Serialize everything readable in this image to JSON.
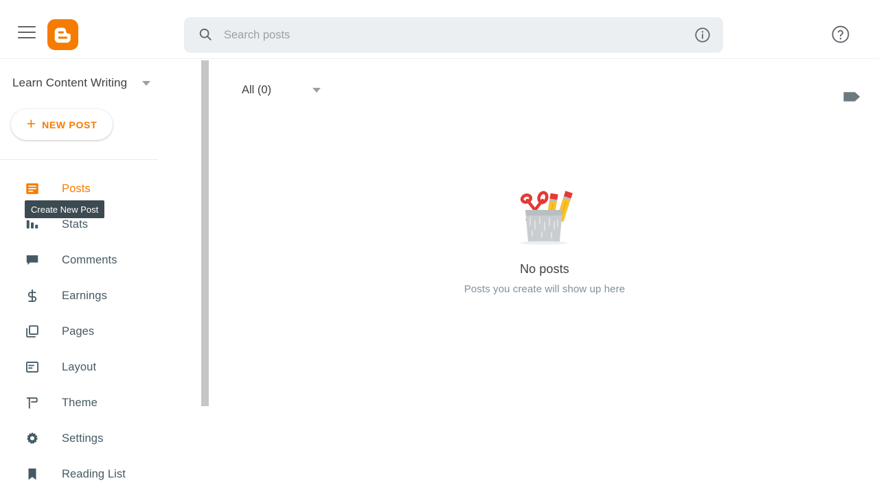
{
  "header": {
    "menu_icon": "hamburger-menu-icon",
    "logo_icon": "blogger-logo-icon",
    "search": {
      "icon": "search-icon",
      "placeholder": "Search posts",
      "value": "",
      "info_icon": "info-icon"
    },
    "help_icon": "help-circle-icon"
  },
  "sidebar": {
    "blog_title": "Learn Content Writing",
    "blog_switch_icon": "chevron-down-icon",
    "new_post": {
      "plus": "+",
      "label": "NEW POST",
      "tooltip": "Create New Post"
    },
    "items": [
      {
        "label": "Posts",
        "icon": "posts-icon",
        "active": true
      },
      {
        "label": "Stats",
        "icon": "stats-icon",
        "active": false
      },
      {
        "label": "Comments",
        "icon": "comments-icon",
        "active": false
      },
      {
        "label": "Earnings",
        "icon": "earnings-icon",
        "active": false
      },
      {
        "label": "Pages",
        "icon": "pages-icon",
        "active": false
      },
      {
        "label": "Layout",
        "icon": "layout-icon",
        "active": false
      },
      {
        "label": "Theme",
        "icon": "theme-icon",
        "active": false
      },
      {
        "label": "Settings",
        "icon": "settings-gear-icon",
        "active": false
      },
      {
        "label": "Reading List",
        "icon": "bookmark-icon",
        "active": false
      }
    ]
  },
  "main": {
    "filter": {
      "label": "All (0)",
      "caret_icon": "chevron-down-icon"
    },
    "label_filter_icon": "label-tag-icon",
    "empty_state": {
      "illustration": "pencil-cup-illustration",
      "title": "No posts",
      "subtitle": "Posts you create will show up here"
    }
  },
  "colors": {
    "brand_orange": "#f57c00",
    "nav_slate": "#455a64",
    "search_bg": "#eceff1",
    "tooltip_bg": "#3c4a52",
    "scrollbar": "#c6c6c6"
  }
}
